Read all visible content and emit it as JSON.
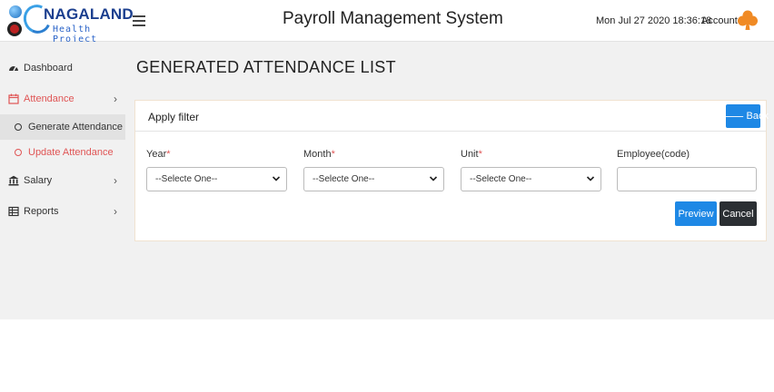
{
  "logo": {
    "title": "NAGALAND",
    "subtitle": "Health Project"
  },
  "header": {
    "app_title": "Payroll Management System",
    "datetime": "Mon Jul 27 2020 18:36:18",
    "account_label": "Account",
    "menu_icon": "hamburger-icon",
    "account_icon": "club-icon",
    "account_icon_color": "#f08a24"
  },
  "sidebar": {
    "items": [
      {
        "label": "Dashboard",
        "icon": "tachometer-icon"
      },
      {
        "label": "Attendance",
        "icon": "calendar-icon",
        "active": true,
        "children": [
          {
            "label": "Generate Attendance",
            "selected": true
          },
          {
            "label": "Update Attendance"
          }
        ]
      },
      {
        "label": "Salary",
        "icon": "bank-icon"
      },
      {
        "label": "Reports",
        "icon": "table-icon"
      }
    ]
  },
  "page": {
    "title": "GENERATED ATTENDANCE LIST"
  },
  "filter": {
    "title": "Apply filter",
    "back_label": "Back",
    "fields": [
      {
        "label": "Year",
        "required_mark": "*",
        "value": "--Selecte One--"
      },
      {
        "label": "Month",
        "required_mark": "*",
        "value": "--Selecte One--"
      },
      {
        "label": "Unit",
        "required_mark": "*",
        "value": "--Selecte One--"
      },
      {
        "label": "Employee(code)",
        "value": ""
      }
    ],
    "preview_label": "Preview",
    "cancel_label": "Cancel"
  },
  "colors": {
    "primary": "#1e88e5",
    "danger_text": "#e05555",
    "dark_button": "#2b2f33",
    "panel_bg": "#f1f1f1"
  }
}
